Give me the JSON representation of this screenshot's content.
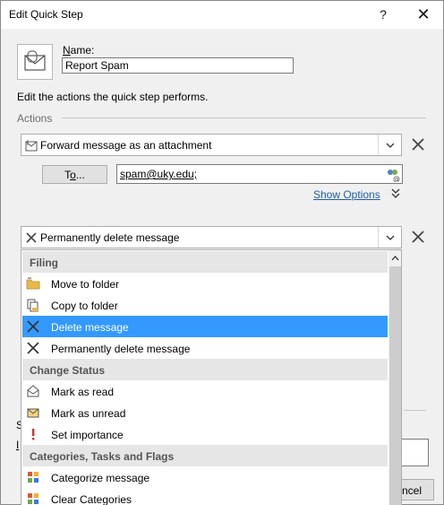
{
  "window": {
    "title": "Edit Quick Step",
    "help_symbol": "?",
    "close_symbol": "✕"
  },
  "name": {
    "label": "Name:",
    "value": "Report Spam"
  },
  "description": "Edit the actions the quick step performs.",
  "actions_label": "Actions",
  "action1": {
    "label": "Forward message as an attachment",
    "icon": "forward-attachment-icon"
  },
  "to": {
    "button_label": "To...",
    "value": "spam@uky.edu;"
  },
  "show_options": "Show Options",
  "action2": {
    "label": "Permanently delete message",
    "icon": "x-icon"
  },
  "dropdown": {
    "groups": [
      {
        "header": "Filing",
        "items": [
          {
            "label": "Move to folder",
            "icon": "folder-move-icon"
          },
          {
            "label": "Copy to folder",
            "icon": "copy-folder-icon"
          },
          {
            "label": "Delete message",
            "icon": "delete-x-icon",
            "selected": true
          },
          {
            "label": "Permanently delete message",
            "icon": "permanent-delete-x-icon"
          }
        ]
      },
      {
        "header": "Change Status",
        "items": [
          {
            "label": "Mark as read",
            "icon": "envelope-open-icon"
          },
          {
            "label": "Mark as unread",
            "icon": "envelope-closed-icon"
          },
          {
            "label": "Set importance",
            "icon": "exclamation-icon"
          }
        ]
      },
      {
        "header": "Categories, Tasks and Flags",
        "items": [
          {
            "label": "Categorize message",
            "icon": "category-grid-icon"
          },
          {
            "label": "Clear Categories",
            "icon": "clear-category-grid-icon"
          }
        ]
      }
    ]
  },
  "background_fragments": {
    "left_s": "S",
    "left_i": "I",
    "cancel_fragment": "ncel"
  },
  "colors": {
    "selection": "#3399ff",
    "link": "#1f5fa8",
    "header_bg": "#e6e6e6"
  }
}
